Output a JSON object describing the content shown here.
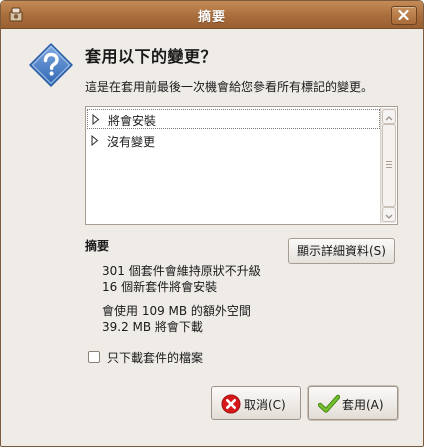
{
  "window": {
    "title": "摘要"
  },
  "dialog": {
    "headline": "套用以下的變更？",
    "description": "這是在套用前最後一次機會給您參看所有標記的變更。"
  },
  "changes": {
    "items": [
      {
        "label": "將會安裝"
      },
      {
        "label": "沒有變更"
      }
    ]
  },
  "summary": {
    "title": "摘要",
    "details_button": "顯示詳細資料(S)",
    "lines": [
      "301 個套件會維持原狀不升級",
      "16 個新套件將會安裝",
      "會使用 109 MB 的額外空間",
      "39.2 MB 將會下載"
    ]
  },
  "options": {
    "download_only_label": "只下載套件的檔案",
    "download_only_checked": false
  },
  "buttons": {
    "cancel": "取消(C)",
    "apply": "套用(A)"
  },
  "icons": {
    "title_icon": "package-manager-icon",
    "close": "close-icon",
    "question": "question-diamond-icon",
    "cancel": "cancel-icon",
    "apply": "checkmark-icon"
  },
  "colors": {
    "titlebar": "#a96d3c",
    "question_icon": "#3d78c8",
    "cancel_icon": "#d7191c",
    "apply_icon": "#5aa51a"
  }
}
